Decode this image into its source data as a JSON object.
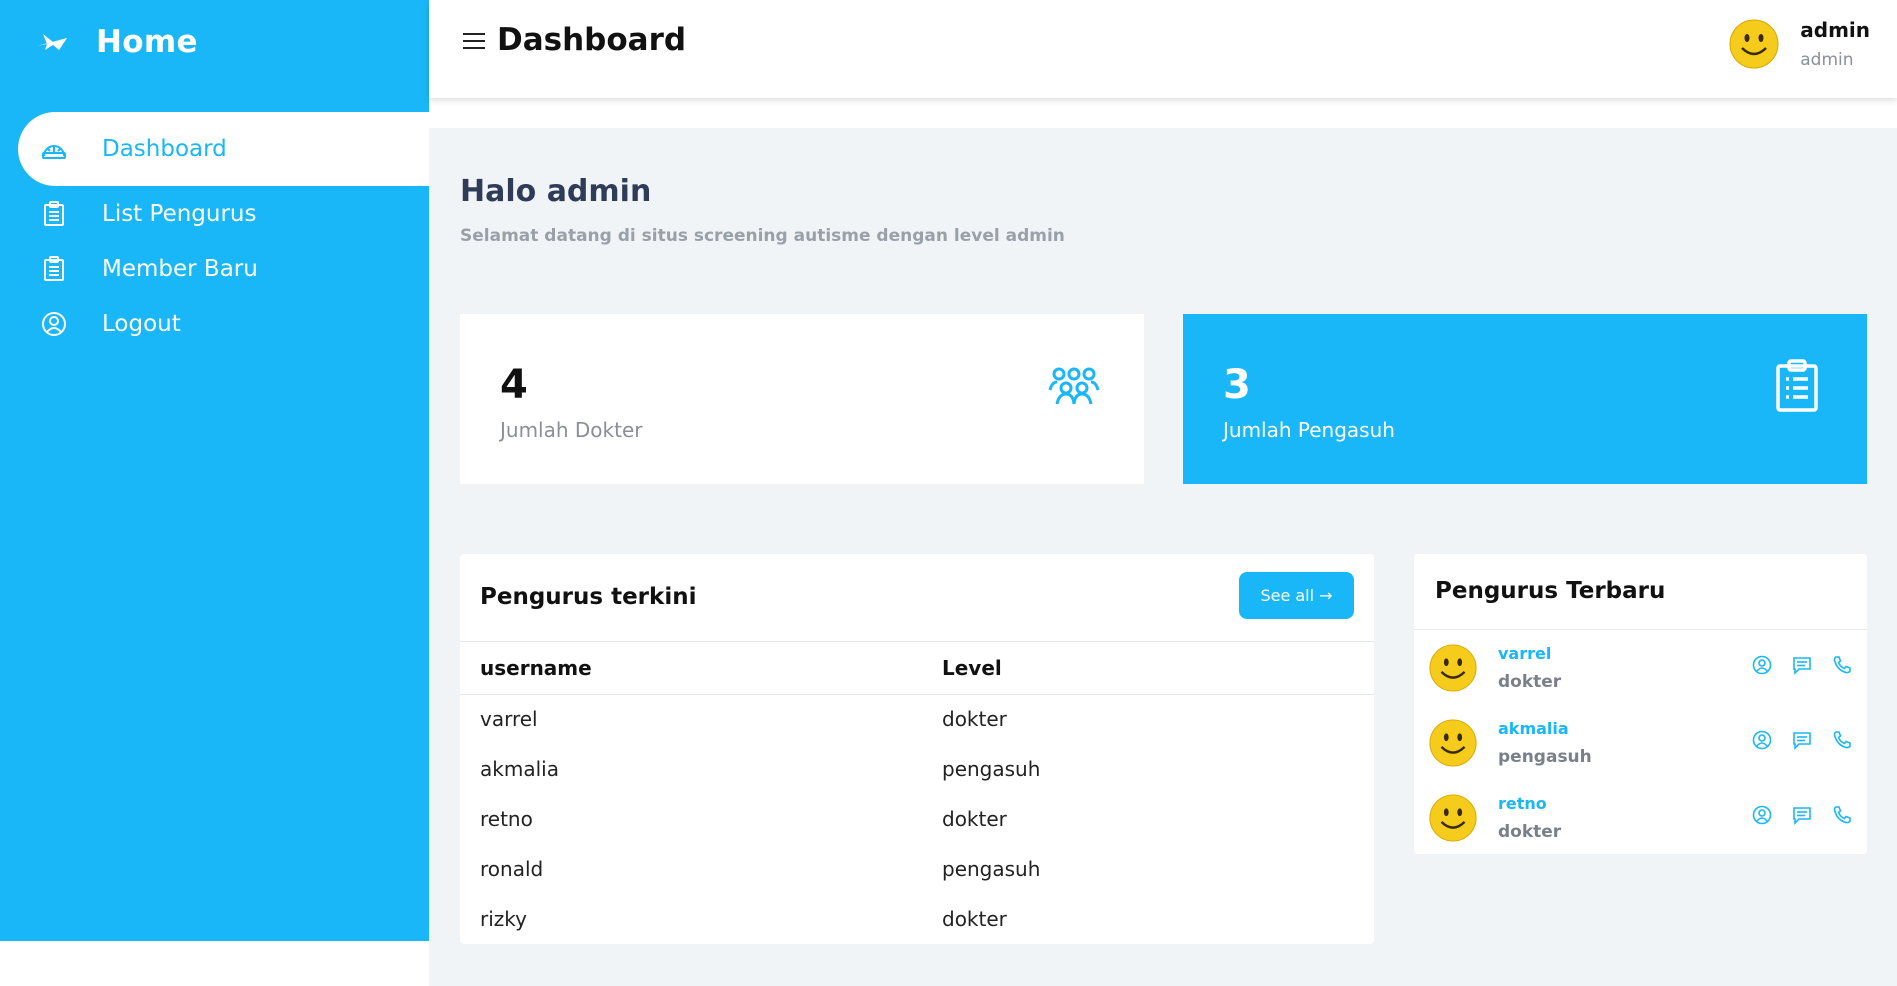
{
  "brand": {
    "title": "Home",
    "icon": "plane-icon"
  },
  "sidebar": {
    "items": [
      {
        "label": "Dashboard",
        "icon": "dashboard-icon",
        "active": true
      },
      {
        "label": "List Pengurus",
        "icon": "clipboard-icon"
      },
      {
        "label": "Member Baru",
        "icon": "clipboard-icon"
      },
      {
        "label": "Logout",
        "icon": "user-circle-icon"
      }
    ]
  },
  "header": {
    "title": "Dashboard",
    "user": {
      "name": "admin",
      "role": "admin"
    }
  },
  "main": {
    "greeting": "Halo admin",
    "subtitle": "Selamat datang di situs screening autisme dengan level admin",
    "stats": [
      {
        "number": "4",
        "label": "Jumlah Dokter",
        "icon": "users-group-icon"
      },
      {
        "number": "3",
        "label": "Jumlah Pengasuh",
        "icon": "clipboard-icon"
      }
    ],
    "table": {
      "title": "Pengurus terkini",
      "see_all": "See all →",
      "headers": [
        "username",
        "Level"
      ],
      "rows": [
        [
          "varrel",
          "dokter"
        ],
        [
          "akmalia",
          "pengasuh"
        ],
        [
          "retno",
          "dokter"
        ],
        [
          "ronald",
          "pengasuh"
        ],
        [
          "rizky",
          "dokter"
        ]
      ]
    },
    "latest": {
      "title": "Pengurus Terbaru",
      "people": [
        {
          "name": "varrel",
          "role": "dokter"
        },
        {
          "name": "akmalia",
          "role": "pengasuh"
        },
        {
          "name": "retno",
          "role": "dokter"
        }
      ]
    }
  },
  "colors": {
    "accent": "#1ab7f8",
    "background": "#f1f4f7",
    "heading": "#2f3c58"
  }
}
